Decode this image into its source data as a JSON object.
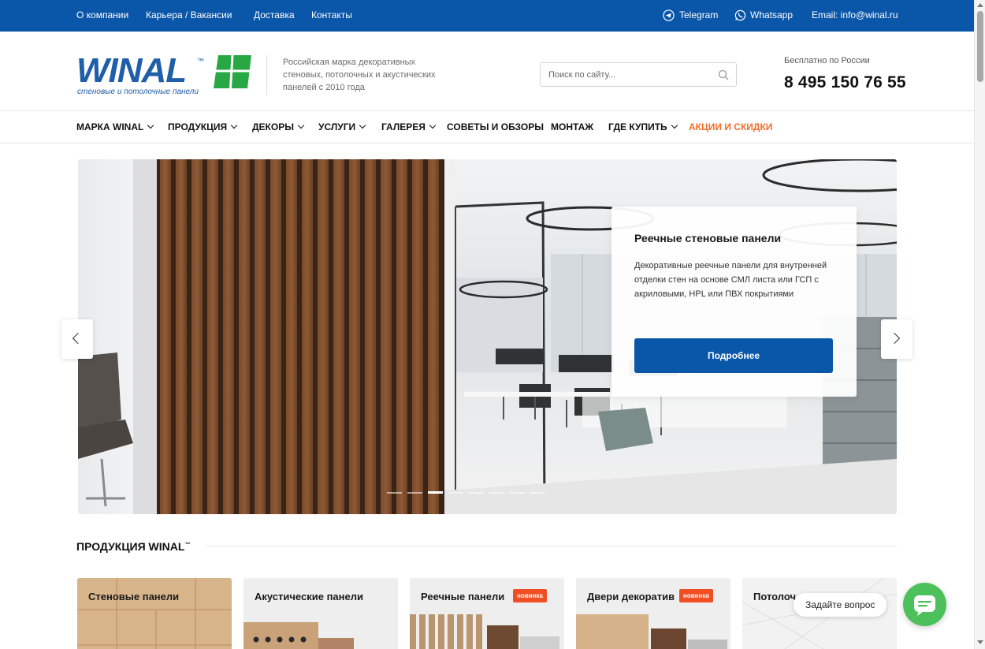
{
  "topbar": {
    "links": [
      "О компании",
      "Карьера / Вакансии",
      "Доставка",
      "Контакты"
    ],
    "telegram": "Telegram",
    "whatsapp": "Whatsapp",
    "email": "Email: info@winal.ru",
    "bg_color": "#0a56a8"
  },
  "header": {
    "logo_text": "WINAL",
    "logo_tm": "™",
    "logo_tagline": "стеновые и потолочные панели",
    "brand_blue": "#1f5ea8",
    "brand_green": "#27a844",
    "description": "Российская марка декоративных стеновых, потолочных и акустических панелей с 2010 года",
    "search_placeholder": "Поиск по сайту...",
    "phone_caption": "Бесплатно по России",
    "phone": "8 495 150 76 55"
  },
  "nav": {
    "items": [
      {
        "label": "МАРКА WINAL",
        "dropdown": true
      },
      {
        "label": "ПРОДУКЦИЯ",
        "dropdown": true
      },
      {
        "label": "ДЕКОРЫ",
        "dropdown": true
      },
      {
        "label": "УСЛУГИ",
        "dropdown": true
      },
      {
        "label": "ГАЛЕРЕЯ",
        "dropdown": true
      },
      {
        "label": "СОВЕТЫ И ОБЗОРЫ",
        "dropdown": false
      },
      {
        "label": "МОНТАЖ",
        "dropdown": false
      },
      {
        "label": "ГДЕ КУПИТЬ",
        "dropdown": true
      },
      {
        "label": "АКЦИИ И СКИДКИ",
        "dropdown": false
      }
    ],
    "sale_color": "#f26d2a"
  },
  "slider": {
    "title": "Реечные стеновые панели",
    "text": "Декоративные реечные панели для внутренней отделки стен на основе СМЛ листа или ГСП с акриловыми, HPL или ПВХ покрытиями",
    "button": "Подробнее",
    "slide_count": 8,
    "active_slide": 3
  },
  "products": {
    "title": "ПРОДУКЦИЯ WINAL",
    "title_tm": "™",
    "cards": [
      {
        "label": "Стеновые панели",
        "badge": ""
      },
      {
        "label": "Акустические панели",
        "badge": ""
      },
      {
        "label": "Реечные панели",
        "badge": "новинка"
      },
      {
        "label": "Двери декоратив",
        "badge": "новинка"
      },
      {
        "label": "Потолоч",
        "badge": ""
      }
    ]
  },
  "chat": {
    "prompt": "Задайте вопрос",
    "color": "#4cc05a"
  }
}
